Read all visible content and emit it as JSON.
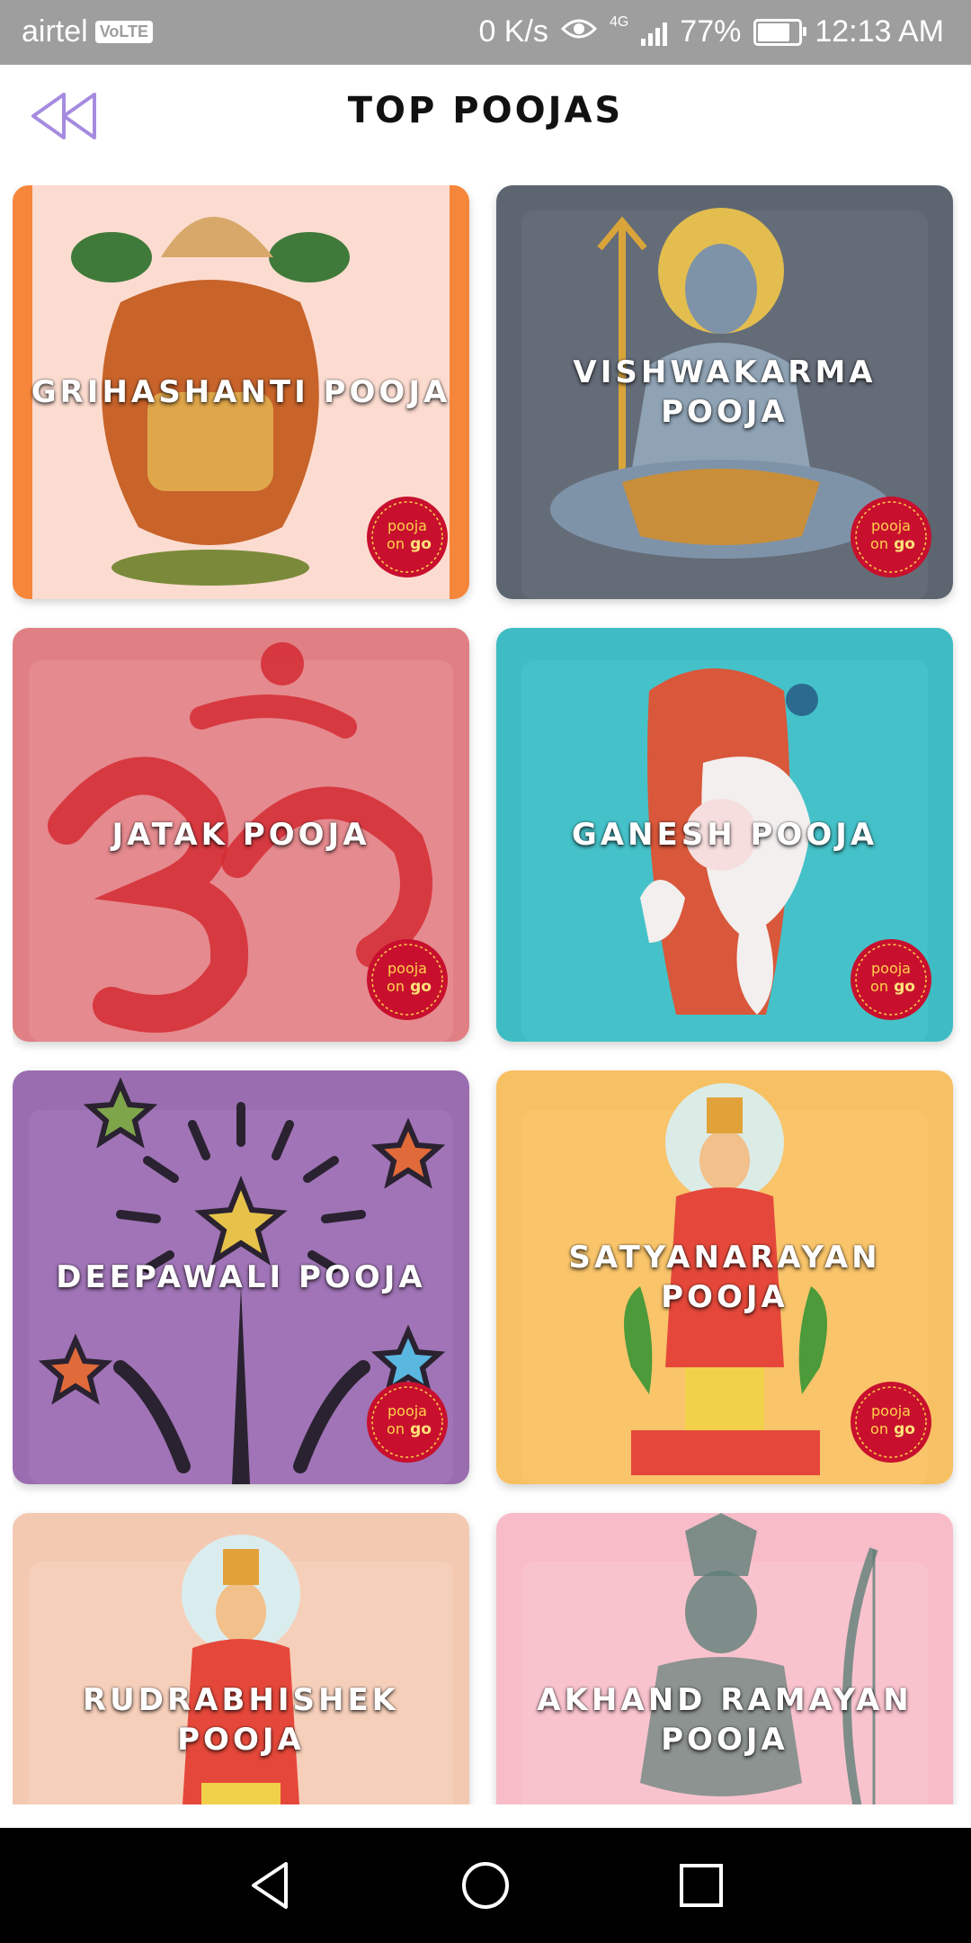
{
  "status_bar": {
    "carrier": "airtel",
    "volte": "VoLTE",
    "net_speed": "0 K/s",
    "network_type": "4G",
    "battery": "77%",
    "battery_level": 0.77,
    "time": "12:13 AM"
  },
  "header": {
    "title": "TOP POOJAS",
    "back_icon": "double-chevron-left-icon"
  },
  "cards": [
    {
      "label": "GRIHASHANTI POOJA",
      "color": "#fcdcd0",
      "accent": "#f5863a",
      "art": "kalash"
    },
    {
      "label": "VISHWAKARMA POOJA",
      "color": "#5d6570",
      "accent": "#5d6570",
      "art": "shiva"
    },
    {
      "label": "JATAK POOJA",
      "color": "#e07f84",
      "accent": "#e07f84",
      "art": "om"
    },
    {
      "label": "GANESH POOJA",
      "color": "#3fbcc3",
      "accent": "#3fbcc3",
      "art": "ganesh"
    },
    {
      "label": "DEEPAWALI POOJA",
      "color": "#9a6db0",
      "accent": "#9a6db0",
      "art": "fireworks"
    },
    {
      "label": "SATYANARAYAN POOJA",
      "color": "#f7c062",
      "accent": "#f7c062",
      "art": "deity"
    },
    {
      "label": "RUDRABHISHEK POOJA",
      "color": "#f4c9b2",
      "accent": "#f4c9b2",
      "art": "deity"
    },
    {
      "label": "AKHAND RAMAYAN POOJA",
      "color": "#f7bcc8",
      "accent": "#f7bcc8",
      "art": "rama"
    }
  ],
  "badge": {
    "line1": "pooja",
    "line2": "on",
    "line3": "go"
  },
  "nav": {
    "back": "back-triangle-icon",
    "home": "home-circle-icon",
    "recents": "recents-square-icon"
  }
}
